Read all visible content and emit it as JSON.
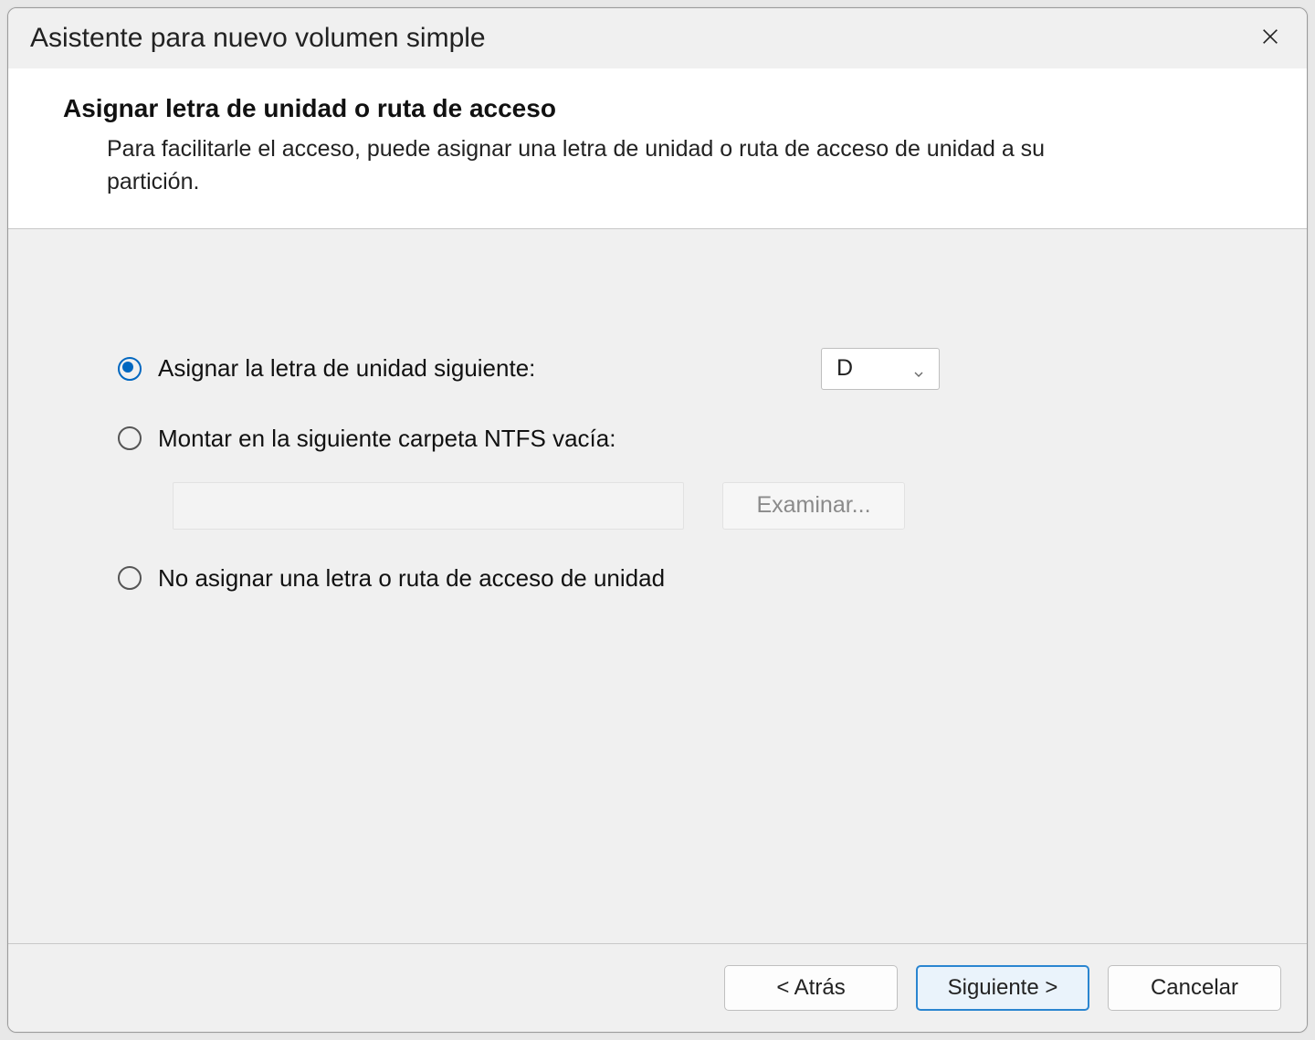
{
  "titlebar": {
    "title": "Asistente para nuevo volumen simple"
  },
  "header": {
    "title": "Asignar letra de unidad o ruta de acceso",
    "description": "Para facilitarle el acceso, puede asignar una letra de unidad o ruta de acceso de unidad a su partición."
  },
  "options": {
    "assign_letter_label": "Asignar la letra de unidad siguiente:",
    "mount_folder_label": "Montar en la siguiente carpeta NTFS vacía:",
    "no_assign_label": "No asignar una letra o ruta de acceso de unidad",
    "selected_drive_letter": "D",
    "mount_path_value": "",
    "browse_label": "Examinar..."
  },
  "footer": {
    "back_label": "< Atrás",
    "next_label": "Siguiente >",
    "cancel_label": "Cancelar"
  }
}
